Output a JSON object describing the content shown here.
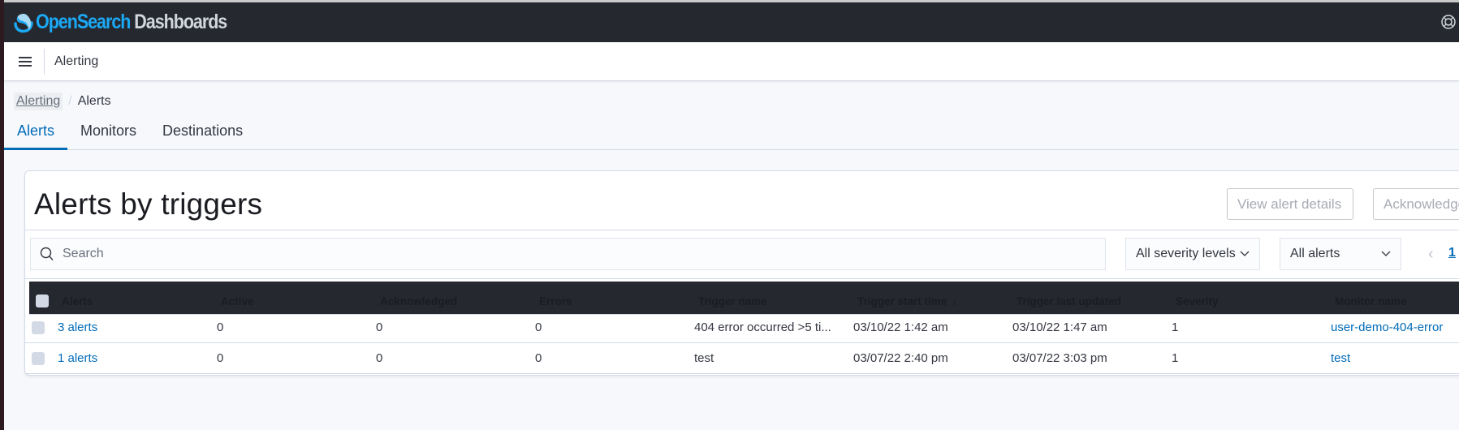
{
  "app": {
    "brand_open": "Open",
    "brand_search": "Search",
    "brand_dashboards": " Dashboards",
    "app_title": "Alerting"
  },
  "breadcrumb": [
    {
      "label": "Alerting"
    },
    {
      "label": "Alerts"
    }
  ],
  "tabs": [
    {
      "label": "Alerts",
      "active": true
    },
    {
      "label": "Monitors",
      "active": false
    },
    {
      "label": "Destinations",
      "active": false
    }
  ],
  "panel": {
    "title": "Alerts by triggers",
    "buttons": {
      "view_details": "View alert details",
      "acknowledge": "Acknowledge"
    },
    "search": {
      "placeholder": "Search",
      "value": ""
    },
    "filters": {
      "severity": "All severity levels",
      "alert_state": "All alerts"
    },
    "pagination": {
      "prev": "‹",
      "current_page": "1"
    }
  },
  "table": {
    "columns": [
      "Alerts",
      "Active",
      "Acknowledged",
      "Errors",
      "Trigger name",
      "Trigger start time",
      "Trigger last updated",
      "Severity",
      "Monitor name"
    ],
    "sort": {
      "column": "Trigger start time",
      "direction": "desc",
      "icon": "↓"
    },
    "rows": [
      {
        "alerts": "3 alerts",
        "active": "0",
        "acknowledged": "0",
        "errors": "0",
        "trigger_name": "404 error occurred >5 ti...",
        "start_time": "03/10/22 1:42 am",
        "last_updated": "03/10/22 1:47 am",
        "severity": "1",
        "monitor_name": "user-demo-404-error"
      },
      {
        "alerts": "1 alerts",
        "active": "0",
        "acknowledged": "0",
        "errors": "0",
        "trigger_name": "test",
        "start_time": "03/07/22 2:40 pm",
        "last_updated": "03/07/22 3:03 pm",
        "severity": "1",
        "monitor_name": "test"
      }
    ]
  },
  "colors": {
    "header_bg": "#25282f",
    "brand_blue": "#1ba9f5",
    "link": "#006bb8",
    "border": "#d3dae6"
  }
}
